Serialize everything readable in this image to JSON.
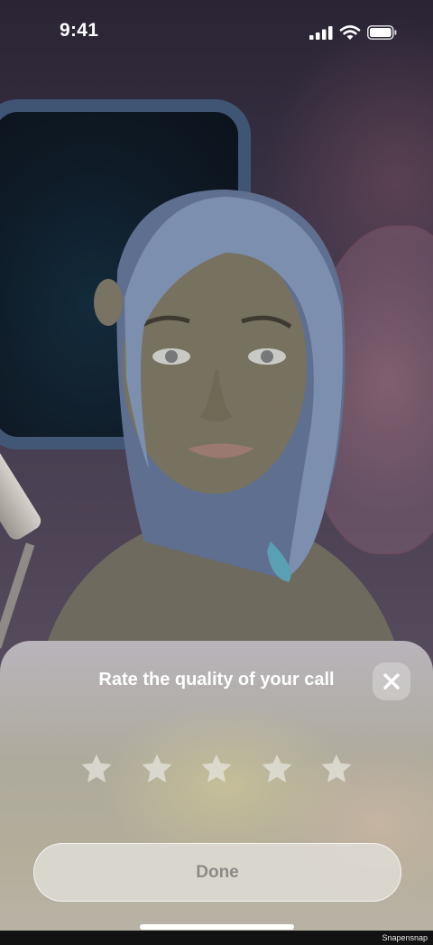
{
  "status_bar": {
    "time": "9:41"
  },
  "rating_sheet": {
    "title": "Rate the quality of your call",
    "close_icon": "close-icon",
    "stars": {
      "count": 5,
      "selected": 0,
      "icon": "star-icon"
    },
    "done_label": "Done"
  },
  "watermark": "Snapensnap",
  "colors": {
    "sheet_title": "#ffffff",
    "done_text": "#8c8a86",
    "star": "#e6e4dc"
  }
}
